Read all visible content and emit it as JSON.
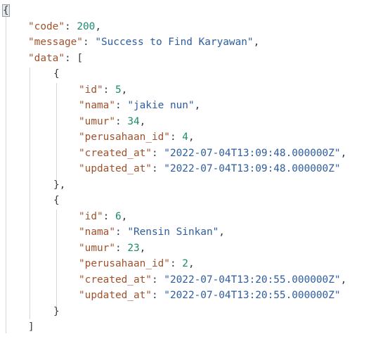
{
  "json_viewer": {
    "open_brace": "{",
    "code_key": "\"code\"",
    "code_value": "200",
    "message_key": "\"message\"",
    "message_value": "\"Success to Find Karyawan\"",
    "data_key": "\"data\"",
    "open_bracket": "[",
    "close_bracket": "]",
    "records": [
      {
        "open": "{",
        "close": "},",
        "id_key": "\"id\"",
        "id": "5",
        "nama_key": "\"nama\"",
        "nama": "\"jakie nun\"",
        "umur_key": "\"umur\"",
        "umur": "34",
        "perusahaan_id_key": "\"perusahaan_id\"",
        "perusahaan_id": "4",
        "created_at_key": "\"created_at\"",
        "created_at": "\"2022-07-04T13:09:48.000000Z\"",
        "updated_at_key": "\"updated_at\"",
        "updated_at": "\"2022-07-04T13:09:48.000000Z\""
      },
      {
        "open": "{",
        "close": "}",
        "id_key": "\"id\"",
        "id": "6",
        "nama_key": "\"nama\"",
        "nama": "\"Rensin Sinkan\"",
        "umur_key": "\"umur\"",
        "umur": "23",
        "perusahaan_id_key": "\"perusahaan_id\"",
        "perusahaan_id": "2",
        "created_at_key": "\"created_at\"",
        "created_at": "\"2022-07-04T13:20:55.000000Z\"",
        "updated_at_key": "\"updated_at\"",
        "updated_at": "\"2022-07-04T13:20:55.000000Z\""
      }
    ],
    "colors": {
      "key": "#a0522d",
      "string": "#2e5d9e",
      "number": "#1a8a6e",
      "punctuation": "#383a42",
      "guide": "#d8d8d8"
    }
  }
}
